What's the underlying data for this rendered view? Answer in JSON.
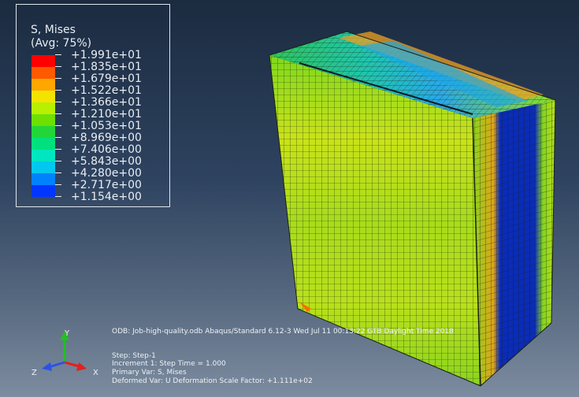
{
  "legend": {
    "title": "S, Mises",
    "subtitle": "(Avg: 75%)",
    "entries": [
      {
        "label": "+1.991e+01",
        "color": "#ff0000"
      },
      {
        "label": "+1.835e+01",
        "color": "#ff5a00"
      },
      {
        "label": "+1.679e+01",
        "color": "#ffa600"
      },
      {
        "label": "+1.522e+01",
        "color": "#f3e400"
      },
      {
        "label": "+1.366e+01",
        "color": "#b7f000"
      },
      {
        "label": "+1.210e+01",
        "color": "#6ee000"
      },
      {
        "label": "+1.053e+01",
        "color": "#22d63a"
      },
      {
        "label": "+8.969e+00",
        "color": "#00e07e"
      },
      {
        "label": "+7.406e+00",
        "color": "#00e6c0"
      },
      {
        "label": "+5.843e+00",
        "color": "#00c8ee"
      },
      {
        "label": "+4.280e+00",
        "color": "#0082ff"
      },
      {
        "label": "+2.717e+00",
        "color": "#0036ff"
      },
      {
        "label": "+1.154e+00",
        "color": ""
      }
    ],
    "bottom_color": "#0000ff"
  },
  "info": {
    "odb": "ODB: Job-high-quality.odb    Abaqus/Standard 6.12-3    Wed Jul 11 00:13:22 GTB Daylight Time 2018",
    "step": "Step: Step-1",
    "increment": "Increment      1: Step Time =     1.000",
    "primary_var": "Primary Var: S, Mises",
    "deformed_var": "Deformed Var: U   Deformation Scale Factor: +1.111e+02"
  },
  "triad": {
    "x": "X",
    "y": "Y",
    "z": "Z",
    "x_color": "#e32020",
    "y_color": "#22c022",
    "z_color": "#2a52e8"
  }
}
